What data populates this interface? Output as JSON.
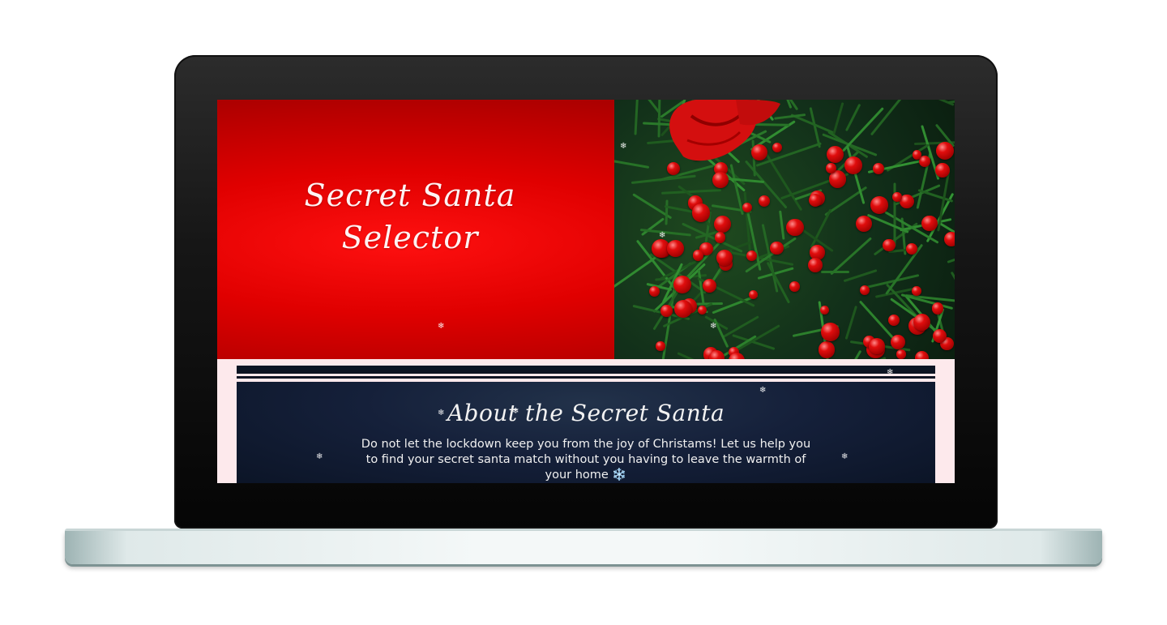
{
  "hero": {
    "title_line1": "Secret Santa",
    "title_line2": "Selector"
  },
  "about": {
    "title": "About the Secret Santa",
    "body": "Do not let the lockdown keep you from the joy of Christams! Let us help you to find your secret santa match without you having to leave the warmth of your home ❄️"
  },
  "decor": {
    "snowflake_glyph": "❄",
    "snowflake_icon": "snowflake-icon"
  },
  "colors": {
    "hero_red": "#e00000",
    "panel_navy": "#15203a",
    "section_pink": "#fde9ec"
  }
}
